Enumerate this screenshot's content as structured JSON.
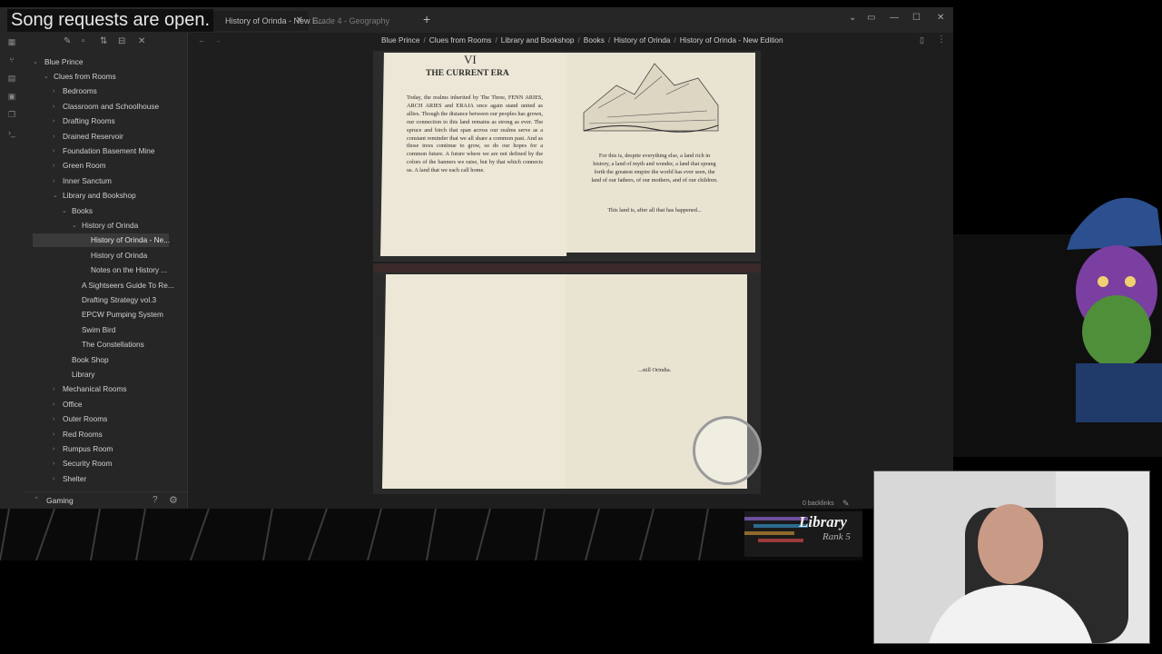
{
  "stream_overlay": {
    "top_text": "Song requests are open.",
    "banner_title": "Library",
    "banner_subtitle": "Rank 5"
  },
  "tabs": [
    {
      "label": "History of Orinda - New E..."
    },
    {
      "label": "Grade 4 - Geography"
    }
  ],
  "breadcrumb": [
    "Blue Prince",
    "Clues from Rooms",
    "Library and Bookshop",
    "Books",
    "History of Orinda",
    "History of Orinda - New Edition"
  ],
  "sidebar": {
    "root": "Blue Prince",
    "items": [
      {
        "label": "Clues from Rooms"
      },
      {
        "label": "Bedrooms"
      },
      {
        "label": "Classroom and Schoolhouse"
      },
      {
        "label": "Drafting Rooms"
      },
      {
        "label": "Drained Reservoir"
      },
      {
        "label": "Foundation Basement Mine"
      },
      {
        "label": "Green Room"
      },
      {
        "label": "Inner Sanctum"
      },
      {
        "label": "Library and Bookshop"
      },
      {
        "label": "Books"
      },
      {
        "label": "History of Orinda"
      },
      {
        "label": "History of Orinda - Ne..."
      },
      {
        "label": "History of Orinda"
      },
      {
        "label": "Notes on the History ..."
      },
      {
        "label": "A Sightseers Guide To Re..."
      },
      {
        "label": "Drafting Strategy vol.3"
      },
      {
        "label": "EPCW Pumping System"
      },
      {
        "label": "Swim Bird"
      },
      {
        "label": "The Constellations"
      },
      {
        "label": "Book Shop"
      },
      {
        "label": "Library"
      },
      {
        "label": "Mechanical Rooms"
      },
      {
        "label": "Office"
      },
      {
        "label": "Outer Rooms"
      },
      {
        "label": "Red Rooms"
      },
      {
        "label": "Rumpus Room"
      },
      {
        "label": "Security Room"
      },
      {
        "label": "Shelter"
      }
    ],
    "vault": "Gaming"
  },
  "book_top": {
    "chapter": "VI",
    "heading": "THE CURRENT ERA",
    "left_text": "Today, the realms inherited by The Three, FENN ARIES, ARCH ARIES and ERAJA once again stand united as allies. Though the distance between our peoples has grown, our connection to this land remains as strong as ever. The spruce and birch that span across our realms serve as a constant reminder that we all share a common past. And as those trees continue to grow, so do our hopes for a common future. A future where we are not defined by the colors of the banners we raise, but by that which connects us. A land that we each call home.",
    "right_text": "For this is, despite everything else, a land rich in history, a land of myth and wonder, a land that sprang forth the greatest empire the world has ever seen, the land of our fathers, of our mothers, and of our children.",
    "right_text_2": "This land is, after all that has happened..."
  },
  "book_bottom": {
    "right_text": "...still Orindia."
  },
  "status": {
    "backlinks": "0 backlinks"
  }
}
